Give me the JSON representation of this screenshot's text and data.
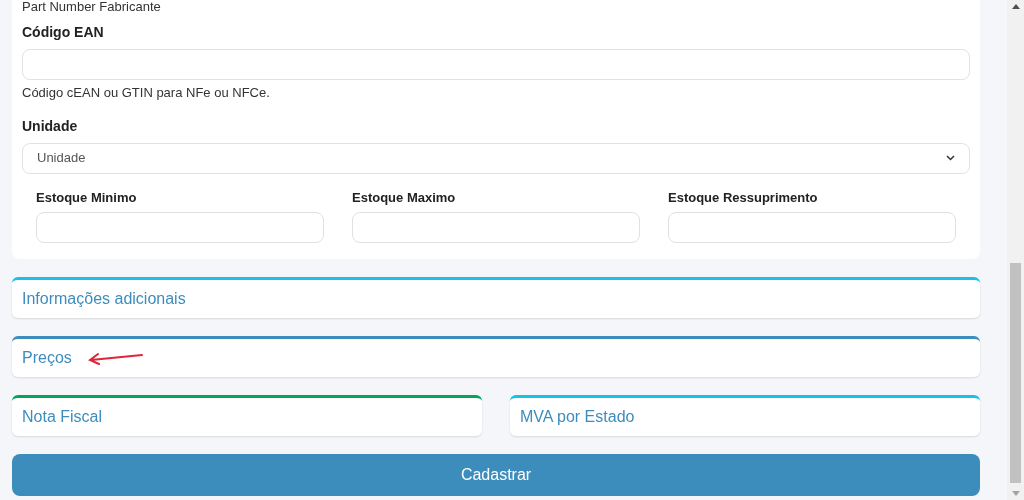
{
  "form": {
    "top_note": "Part Number Fabricante",
    "ean": {
      "label": "Código EAN",
      "help": "Código cEAN ou GTIN para NFe ou NFCe."
    },
    "unit": {
      "label": "Unidade",
      "value": "Unidade"
    },
    "stock_fields": [
      {
        "label": "Estoque Minimo"
      },
      {
        "label": "Estoque Maximo"
      },
      {
        "label": "Estoque Ressuprimento"
      }
    ]
  },
  "panels": [
    {
      "title": "Informações adicionais",
      "color": "#17c1e8",
      "marked": false
    },
    {
      "title": "Preços",
      "color": "#3c8dbc",
      "marked": true
    }
  ],
  "panel_pair": [
    {
      "title": "Nota Fiscal",
      "color": "#00a65a"
    },
    {
      "title": "MVA por Estado",
      "color": "#17c1e8"
    }
  ],
  "submit": "Cadastrar"
}
